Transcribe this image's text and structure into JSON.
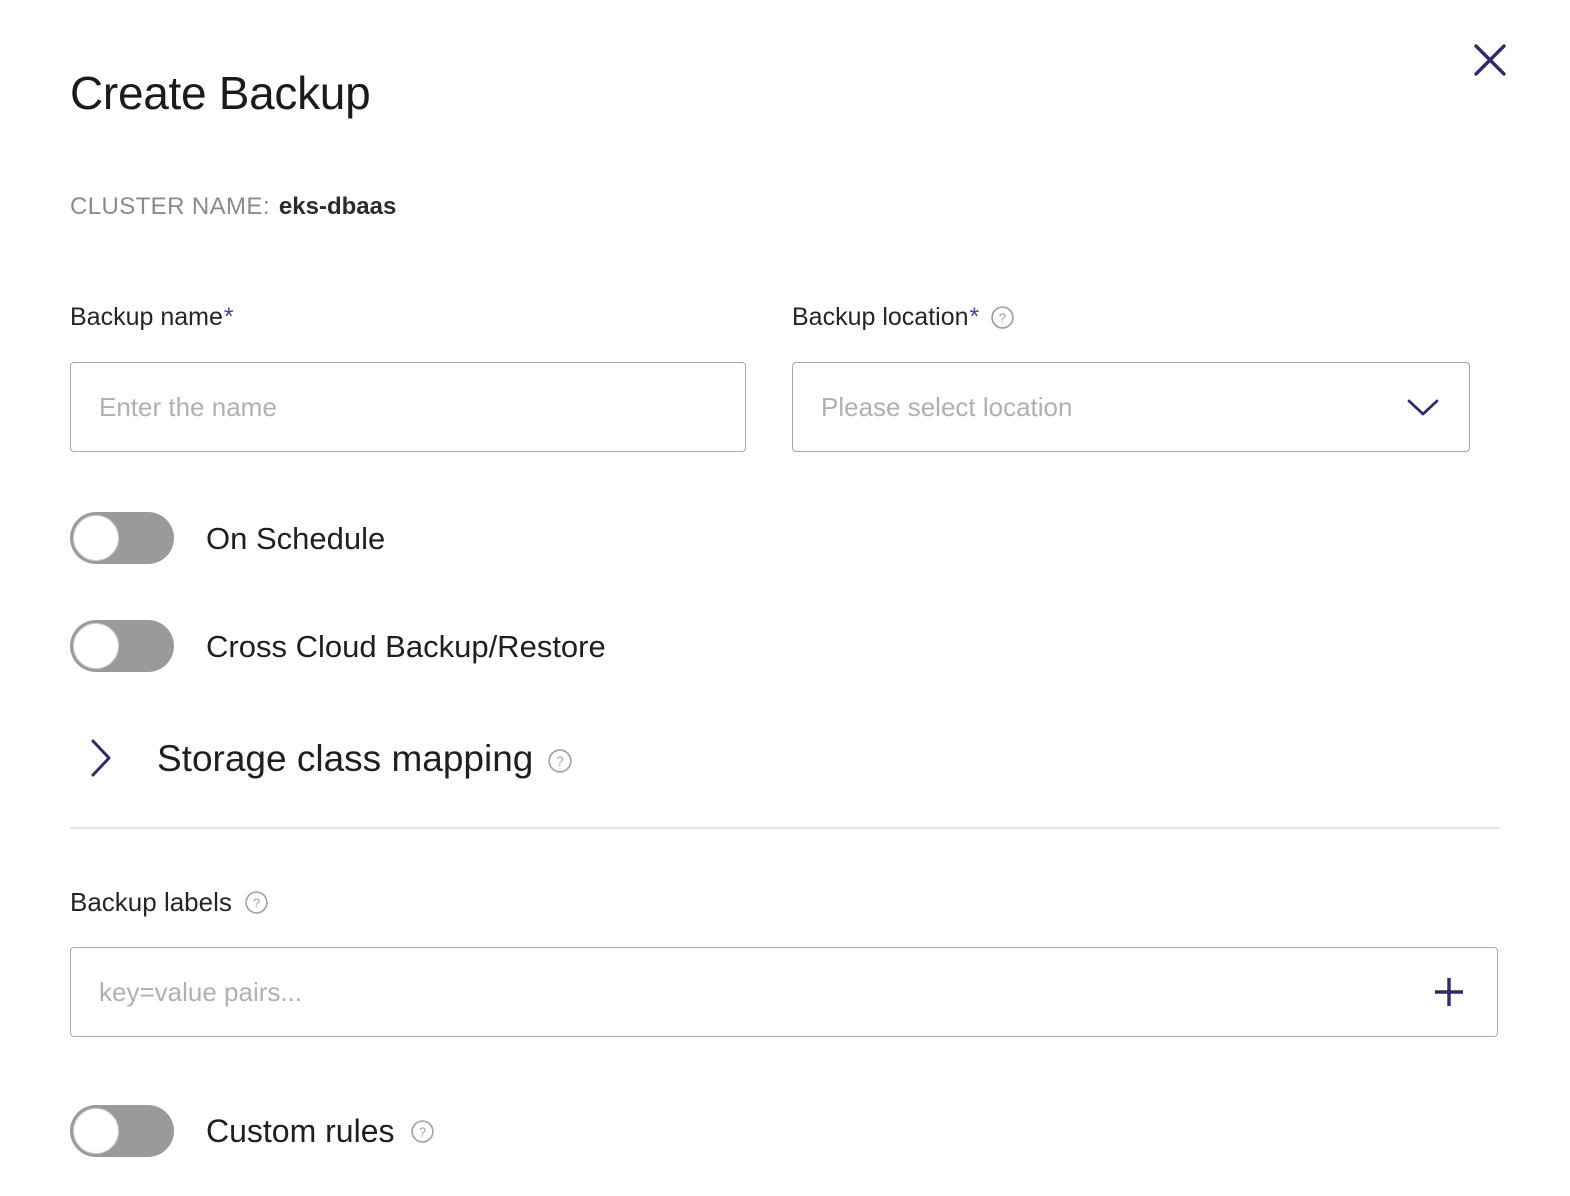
{
  "dialog": {
    "title": "Create Backup",
    "close_icon": "close-icon",
    "cluster": {
      "label": "CLUSTER NAME:",
      "value": "eks-dbaas"
    }
  },
  "form": {
    "backup_name": {
      "label": "Backup name",
      "required_marker": "*",
      "value": "",
      "placeholder": "Enter the name"
    },
    "backup_location": {
      "label": "Backup location",
      "required_marker": "*",
      "help_icon": "help-circle-icon",
      "selected": "Please select location",
      "chevron_icon": "chevron-down-icon"
    },
    "on_schedule": {
      "label": "On Schedule",
      "state": "off"
    },
    "cross_cloud": {
      "label": "Cross Cloud Backup/Restore",
      "state": "off"
    },
    "storage_class_mapping": {
      "label": "Storage class mapping",
      "chevron_icon": "chevron-right-icon",
      "help_icon": "help-circle-icon",
      "expanded": "false"
    },
    "backup_labels": {
      "label": "Backup labels",
      "help_icon": "help-circle-icon",
      "value": "",
      "placeholder": "key=value pairs...",
      "add_icon": "plus-icon"
    },
    "custom_rules": {
      "label": "Custom rules",
      "help_icon": "help-circle-icon",
      "state": "off"
    }
  },
  "colors": {
    "accent": "#312a6c",
    "required": "#4a3f9b",
    "toggle_off_track": "#9a9a9a",
    "border": "#a8a8a8",
    "placeholder": "#b0b0b0",
    "muted_text": "#8a8a8a",
    "divider": "#e6e6e6"
  }
}
